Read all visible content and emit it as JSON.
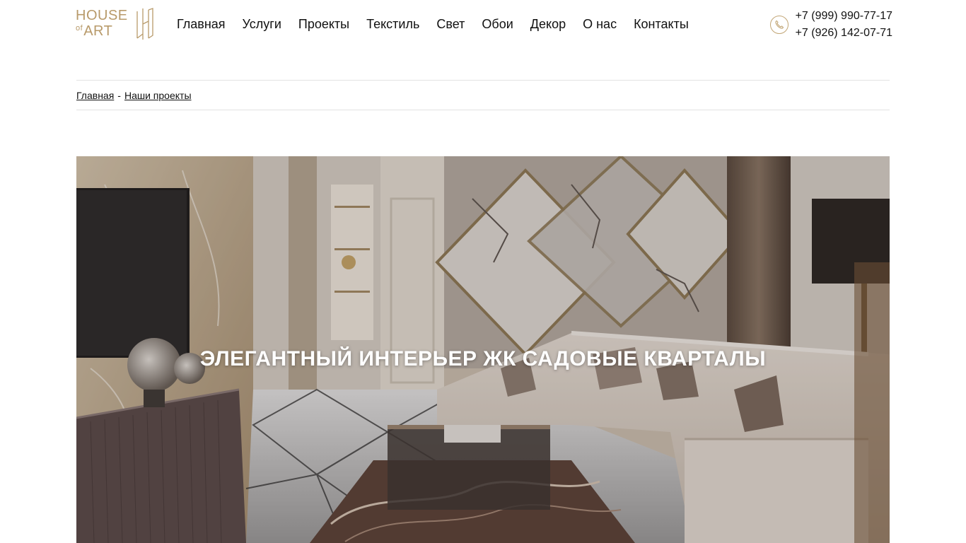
{
  "logo": {
    "line1": "HOUSE",
    "of": "of",
    "art": "ART",
    "color": "#b89a6a"
  },
  "nav": {
    "items": [
      {
        "label": "Главная"
      },
      {
        "label": "Услуги"
      },
      {
        "label": "Проекты"
      },
      {
        "label": "Текстиль"
      },
      {
        "label": "Свет"
      },
      {
        "label": "Обои"
      },
      {
        "label": "Декор"
      },
      {
        "label": "О нас"
      },
      {
        "label": "Контакты"
      }
    ]
  },
  "contacts": {
    "icon": "phone-icon",
    "phone1": "+7 (999) 990-77-17",
    "phone2": "+7 (926) 142-07-71"
  },
  "breadcrumb": {
    "home": "Главная",
    "separator": "-",
    "current": "Наши проекты"
  },
  "hero": {
    "title": "ЭЛЕГАНТНЫЙ ИНТЕРЬЕР ЖК САДОВЫЕ КВАРТАЛЫ"
  },
  "colors": {
    "accent": "#b89a6a",
    "divider": "#e3e3e3"
  }
}
